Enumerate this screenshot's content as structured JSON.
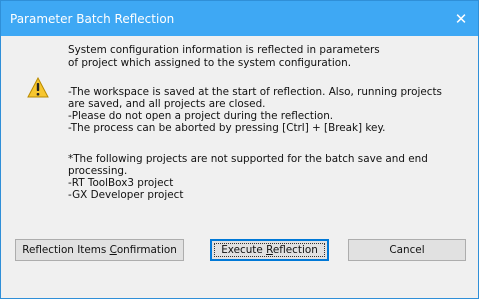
{
  "dialog": {
    "title": "Parameter Batch Reflection",
    "close_glyph": "✕"
  },
  "message": {
    "line1": "System configuration information is reflected in parameters",
    "line2": "of project which assigned to the system configuration.",
    "line3": "-The workspace is saved at the start of reflection. Also, running projects",
    "line4": " are saved, and all projects are closed.",
    "line5": "-Please do not open a project during the reflection.",
    "line6": "-The process can be aborted by pressing [Ctrl] + [Break] key.",
    "line7": "*The following projects are not supported for the batch save and end",
    "line8": "processing.",
    "line9": "-RT ToolBox3 project",
    "line10": "-GX Developer project"
  },
  "buttons": {
    "confirm_prefix": "Reflection Items ",
    "confirm_mnemonic": "C",
    "confirm_suffix": "onfirmation",
    "execute_prefix": "Execute ",
    "execute_mnemonic": "R",
    "execute_suffix": "eflection",
    "cancel": "Cancel"
  },
  "colors": {
    "titlebar": "#3ea8f4",
    "dialog_bg": "#f0f0f0",
    "button_bg": "#e1e1e1",
    "default_border": "#0078d7",
    "warning_yellow": "#f7c62f"
  },
  "icons": {
    "warning": "warning-icon",
    "close": "close-icon"
  }
}
